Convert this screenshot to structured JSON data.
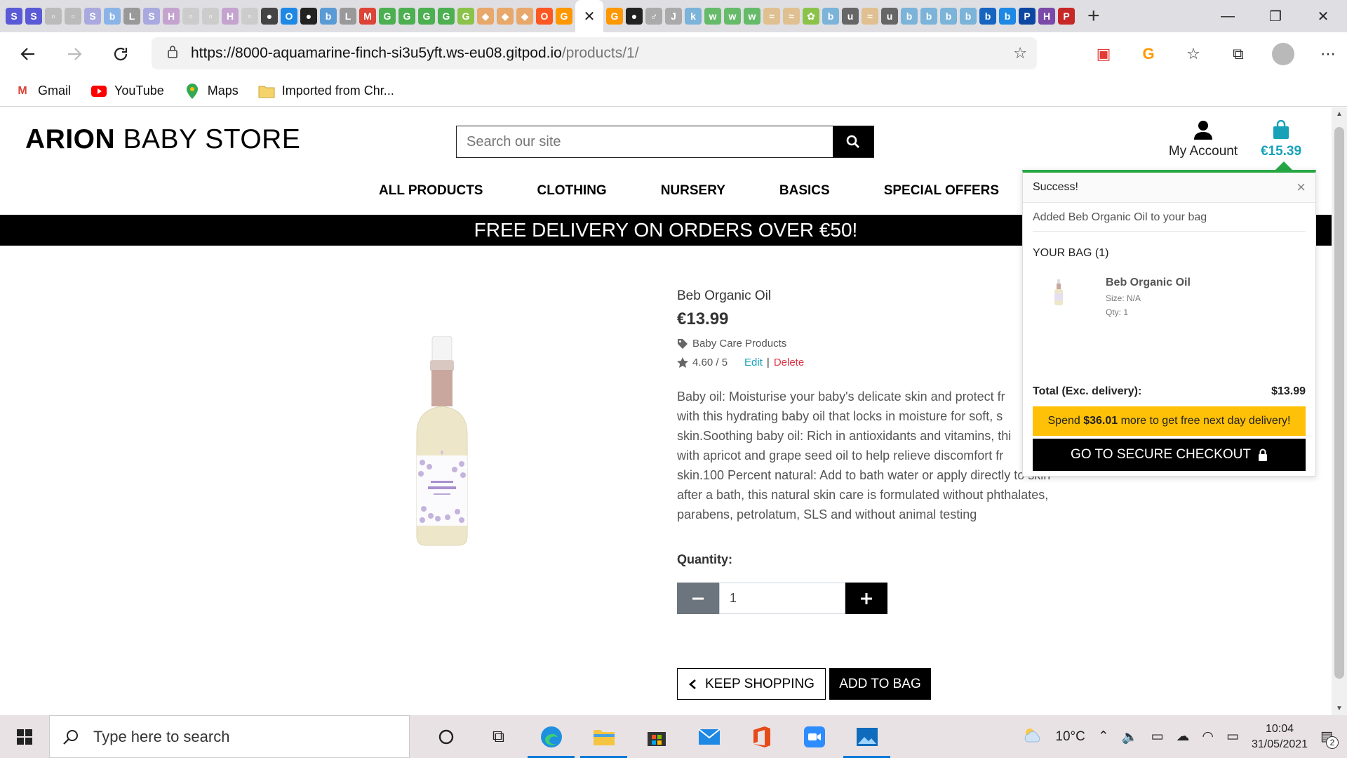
{
  "browser": {
    "url_host": "https://8000-aquamarine-finch-si3u5yft.ws-eu08.gitpod.io",
    "url_path": "/products/1/",
    "active_tab_close": "✕",
    "bookmarks": [
      {
        "label": "Gmail",
        "icon": "gmail-icon"
      },
      {
        "label": "YouTube",
        "icon": "youtube-icon"
      },
      {
        "label": "Maps",
        "icon": "maps-icon"
      },
      {
        "label": "Imported from Chr...",
        "icon": "folder-icon"
      }
    ]
  },
  "store": {
    "logo_bold": "ARION",
    "logo_rest": " BABY STORE",
    "search_placeholder": "Search our site",
    "account_label": "My Account",
    "bag_total": "€15.39",
    "nav": [
      "ALL PRODUCTS",
      "CLOTHING",
      "NURSERY",
      "BASICS",
      "SPECIAL OFFERS"
    ],
    "banner": "FREE DELIVERY ON ORDERS OVER €50!"
  },
  "product": {
    "name": "Beb Organic Oil",
    "price": "€13.99",
    "category": "Baby Care Products",
    "rating": "4.60 / 5",
    "edit_label": "Edit",
    "separator": "|",
    "delete_label": "Delete",
    "description_lines": [
      "Baby oil: Moisturise your baby's delicate skin and protect fr",
      "with this hydrating baby oil that locks in moisture for soft, s",
      "skin.Soothing baby oil: Rich in antioxidants and vitamins, thi",
      "with apricot and grape seed oil to help relieve discomfort fr",
      "skin.100 Percent natural: Add to bath water or apply directly to skin",
      "after a bath, this natural skin care is formulated without phthalates,",
      "parabens, petrolatum, SLS and without animal testing"
    ],
    "quantity_label": "Quantity:",
    "quantity_value": "1",
    "keep_shopping": "KEEP SHOPPING",
    "add_to_bag": "ADD TO BAG"
  },
  "toast": {
    "title": "Success!",
    "message": "Added Beb Organic Oil to your bag",
    "bag_title": "YOUR BAG (1)",
    "item_name": "Beb Organic Oil",
    "item_size": "Size: N/A",
    "item_qty": "Qty: 1",
    "total_label": "Total (Exc. delivery):",
    "total_value": "$13.99",
    "spend_pre": "Spend ",
    "spend_amount": "$36.01",
    "spend_post": " more to get free next day delivery!",
    "checkout": "GO TO SECURE CHECKOUT"
  },
  "taskbar": {
    "search_placeholder": "Type here to search",
    "weather": "10°C",
    "time": "10:04",
    "date": "31/05/2021",
    "notifications": "2"
  },
  "colors": {
    "accent": "#17a2b8",
    "success": "#28a745",
    "warning": "#ffc107",
    "danger": "#dc3545"
  }
}
